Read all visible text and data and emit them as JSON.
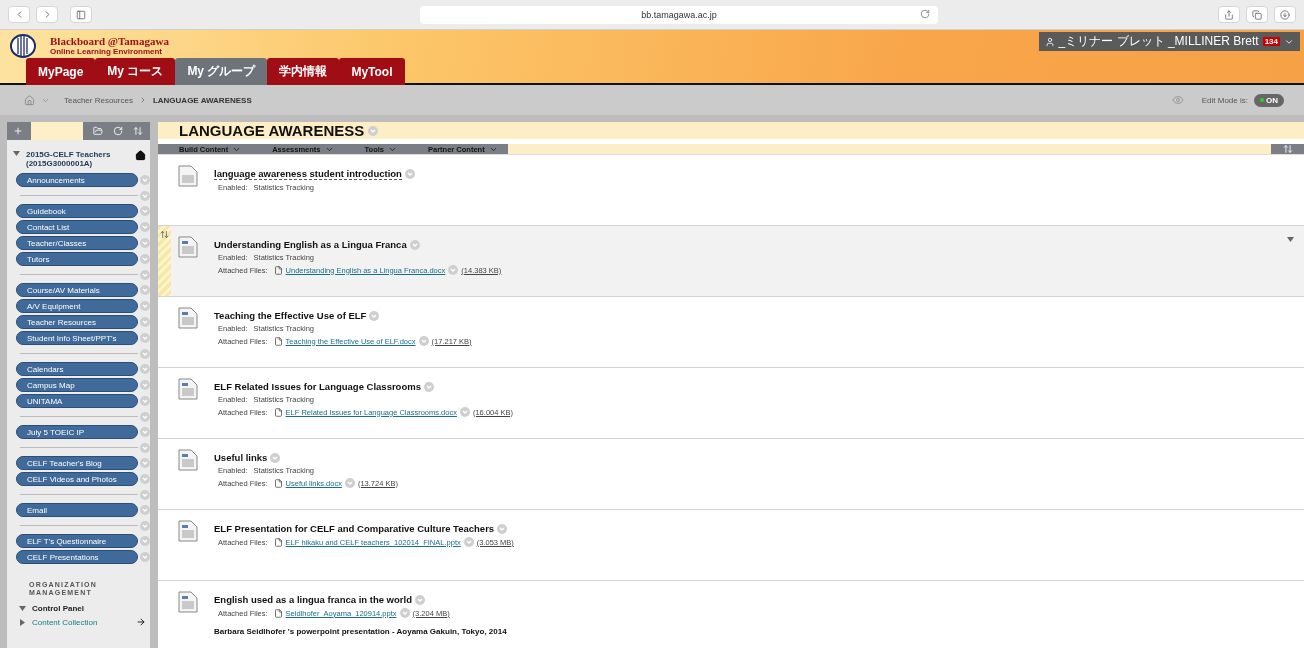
{
  "browser": {
    "url": "bb.tamagawa.ac.jp"
  },
  "header": {
    "logo_title": "Blackboard @Tamagawa",
    "logo_subtitle": "Online Learning Environment",
    "user": "_ミリナー ブレット _MILLINER Brett",
    "badge": "134"
  },
  "tabs": [
    {
      "label": "MyPage",
      "selected": false
    },
    {
      "label": "My コース",
      "selected": false
    },
    {
      "label": "My グループ",
      "selected": true
    },
    {
      "label": "学内情報",
      "selected": false
    },
    {
      "label": "MyTool",
      "selected": false
    }
  ],
  "breadcrumb": [
    "Teacher Resources",
    "LANGUAGE AWARENESS"
  ],
  "edit_mode": {
    "label": "Edit Mode is:",
    "value": "ON",
    "on": true
  },
  "sidebar": {
    "course_title": "2015G-CELF Teachers (2015G3000001A)",
    "items": [
      {
        "kind": "link",
        "label": "Announcements"
      },
      {
        "kind": "divider"
      },
      {
        "kind": "link",
        "label": "Guidebook"
      },
      {
        "kind": "link",
        "label": "Contact List"
      },
      {
        "kind": "link",
        "label": "Teacher/Classes"
      },
      {
        "kind": "link",
        "label": "Tutors"
      },
      {
        "kind": "divider"
      },
      {
        "kind": "link",
        "label": "Course/AV Materials"
      },
      {
        "kind": "link",
        "label": "A/V Equipment"
      },
      {
        "kind": "link",
        "label": "Teacher Resources"
      },
      {
        "kind": "link",
        "label": "Student Info Sheet/PPT's"
      },
      {
        "kind": "divider"
      },
      {
        "kind": "link",
        "label": "Calendars"
      },
      {
        "kind": "link",
        "label": "Campus Map"
      },
      {
        "kind": "link",
        "label": "UNITAMA"
      },
      {
        "kind": "divider"
      },
      {
        "kind": "link",
        "label": "July 5 TOEIC IP"
      },
      {
        "kind": "divider"
      },
      {
        "kind": "link",
        "label": "CELF Teacher's Blog"
      },
      {
        "kind": "link",
        "label": "CELF Videos and Photos"
      },
      {
        "kind": "divider"
      },
      {
        "kind": "link",
        "label": "Email"
      },
      {
        "kind": "divider"
      },
      {
        "kind": "link",
        "label": "ELF T's Questionnaire"
      },
      {
        "kind": "link",
        "label": "CELF Presentations"
      }
    ],
    "management_heading": "ORGANIZATION MANAGEMENT",
    "management": [
      {
        "label": "Control Panel",
        "expanded": true,
        "kind": "heading"
      },
      {
        "label": "Content Collection",
        "expanded": false,
        "kind": "link"
      }
    ]
  },
  "page_title": "LANGUAGE AWARENESS",
  "action_bar": [
    "Build Content",
    "Assessments",
    "Tools",
    "Partner Content"
  ],
  "content_items": [
    {
      "title": "language awareness student introduction",
      "highlighted": false,
      "kind": "plain",
      "enabled_label": "Enabled:",
      "enabled": "Statistics Tracking"
    },
    {
      "title": "Understanding English as a Lingua Franca",
      "highlighted": true,
      "kind": "file",
      "enabled_label": "Enabled:",
      "enabled": "Statistics Tracking",
      "files_label": "Attached Files:",
      "file": "Understanding English as a Lingua Franca.docx",
      "size": "(14.383 KB)"
    },
    {
      "title": "Teaching the Effective Use of ELF",
      "highlighted": false,
      "kind": "file",
      "enabled_label": "Enabled:",
      "enabled": "Statistics Tracking",
      "files_label": "Attached Files:",
      "file": "Teaching the Effective Use of ELF.docx",
      "size": "(17.217 KB)"
    },
    {
      "title": "ELF Related Issues for Language Classrooms",
      "highlighted": false,
      "kind": "file",
      "enabled_label": "Enabled:",
      "enabled": "Statistics Tracking",
      "files_label": "Attached Files:",
      "file": "ELF Related Issues for Language Classrooms.docx",
      "size": "(16.004 KB)"
    },
    {
      "title": "Useful links",
      "highlighted": false,
      "kind": "file",
      "enabled_label": "Enabled:",
      "enabled": "Statistics Tracking",
      "files_label": "Attached Files:",
      "file": "Useful links.docx",
      "size": "(13.724 KB)"
    },
    {
      "title": "ELF Presentation for CELF and Comparative Culture Teachers",
      "highlighted": false,
      "kind": "file",
      "files_label": "Attached Files:",
      "file": "ELF hikaku and CELF teachers_102014_FINAL.pptx",
      "size": "(3.053 MB)"
    },
    {
      "title": "English used as a lingua franca in the world",
      "highlighted": false,
      "kind": "file",
      "files_label": "Attached Files:",
      "file": "Seidlhofer_Aoyama_120914.pptx",
      "size": "(3.204 MB)",
      "description": "Barbara Seidlhofer 's powerpoint  presentation - Aoyama Gakuin, Tokyo, 2014"
    }
  ]
}
